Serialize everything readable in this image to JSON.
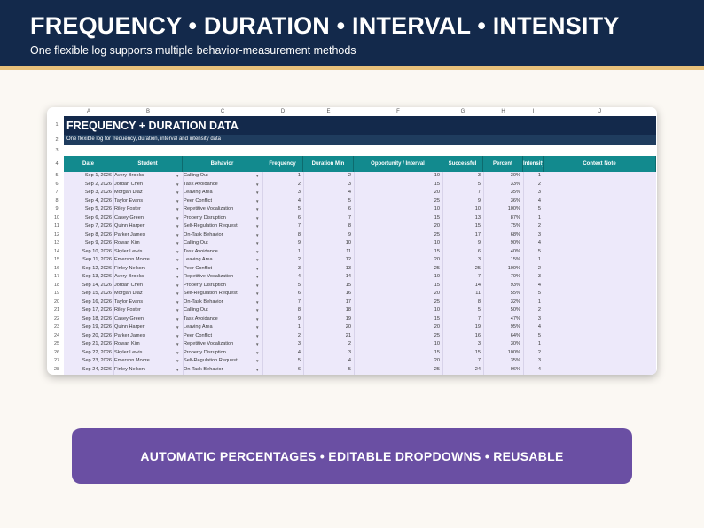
{
  "banner": {
    "title": "FREQUENCY • DURATION • INTERVAL • INTENSITY",
    "subtitle": "One flexible log supports multiple behavior-measurement methods"
  },
  "sheet": {
    "column_letters": [
      "A",
      "B",
      "C",
      "D",
      "E",
      "F",
      "G",
      "H",
      "I",
      "J"
    ],
    "title": "FREQUENCY + DURATION DATA",
    "subtitle": "One flexible log for frequency, duration, interval and intensity data",
    "headers": [
      "Date",
      "Student",
      "Behavior",
      "Frequency",
      "Duration Min",
      "Opportunity / Interval",
      "Successful",
      "Percent",
      "Intensity",
      "Context Note"
    ],
    "dropdown_glyph": "▼",
    "rows": [
      [
        "Sep 1, 2026",
        "Avery Brooks",
        "Calling Out",
        "1",
        "2",
        "10",
        "3",
        "30%",
        "1"
      ],
      [
        "Sep 2, 2026",
        "Jordan Chen",
        "Task Avoidance",
        "2",
        "3",
        "15",
        "5",
        "33%",
        "2"
      ],
      [
        "Sep 3, 2026",
        "Morgan Diaz",
        "Leaving Area",
        "3",
        "4",
        "20",
        "7",
        "35%",
        "3"
      ],
      [
        "Sep 4, 2026",
        "Taylor Evans",
        "Peer Conflict",
        "4",
        "5",
        "25",
        "9",
        "36%",
        "4"
      ],
      [
        "Sep 5, 2026",
        "Riley Foster",
        "Repetitive Vocalization",
        "5",
        "6",
        "10",
        "10",
        "100%",
        "5"
      ],
      [
        "Sep 6, 2026",
        "Casey Green",
        "Property Disruption",
        "6",
        "7",
        "15",
        "13",
        "87%",
        "1"
      ],
      [
        "Sep 7, 2026",
        "Quinn Harper",
        "Self-Regulation Request",
        "7",
        "8",
        "20",
        "15",
        "75%",
        "2"
      ],
      [
        "Sep 8, 2026",
        "Parker James",
        "On-Task Behavior",
        "8",
        "9",
        "25",
        "17",
        "68%",
        "3"
      ],
      [
        "Sep 9, 2026",
        "Rowan Kim",
        "Calling Out",
        "9",
        "10",
        "10",
        "9",
        "90%",
        "4"
      ],
      [
        "Sep 10, 2026",
        "Skyler Lewis",
        "Task Avoidance",
        "1",
        "11",
        "15",
        "6",
        "40%",
        "5"
      ],
      [
        "Sep 11, 2026",
        "Emerson Moore",
        "Leaving Area",
        "2",
        "12",
        "20",
        "3",
        "15%",
        "1"
      ],
      [
        "Sep 12, 2026",
        "Finley Nelson",
        "Peer Conflict",
        "3",
        "13",
        "25",
        "25",
        "100%",
        "2"
      ],
      [
        "Sep 13, 2026",
        "Avery Brooks",
        "Repetitive Vocalization",
        "4",
        "14",
        "10",
        "7",
        "70%",
        "3"
      ],
      [
        "Sep 14, 2026",
        "Jordan Chen",
        "Property Disruption",
        "5",
        "15",
        "15",
        "14",
        "93%",
        "4"
      ],
      [
        "Sep 15, 2026",
        "Morgan Diaz",
        "Self-Regulation Request",
        "6",
        "16",
        "20",
        "11",
        "55%",
        "5"
      ],
      [
        "Sep 16, 2026",
        "Taylor Evans",
        "On-Task Behavior",
        "7",
        "17",
        "25",
        "8",
        "32%",
        "1"
      ],
      [
        "Sep 17, 2026",
        "Riley Foster",
        "Calling Out",
        "8",
        "18",
        "10",
        "5",
        "50%",
        "2"
      ],
      [
        "Sep 18, 2026",
        "Casey Green",
        "Task Avoidance",
        "9",
        "19",
        "15",
        "7",
        "47%",
        "3"
      ],
      [
        "Sep 19, 2026",
        "Quinn Harper",
        "Leaving Area",
        "1",
        "20",
        "20",
        "19",
        "95%",
        "4"
      ],
      [
        "Sep 20, 2026",
        "Parker James",
        "Peer Conflict",
        "2",
        "21",
        "25",
        "16",
        "64%",
        "5"
      ],
      [
        "Sep 21, 2026",
        "Rowan Kim",
        "Repetitive Vocalization",
        "3",
        "2",
        "10",
        "3",
        "30%",
        "1"
      ],
      [
        "Sep 22, 2026",
        "Skyler Lewis",
        "Property Disruption",
        "4",
        "3",
        "15",
        "15",
        "100%",
        "2"
      ],
      [
        "Sep 23, 2026",
        "Emerson Moore",
        "Self-Regulation Request",
        "5",
        "4",
        "20",
        "7",
        "35%",
        "3"
      ],
      [
        "Sep 24, 2026",
        "Finley Nelson",
        "On-Task Behavior",
        "6",
        "5",
        "25",
        "24",
        "96%",
        "4"
      ]
    ]
  },
  "footer": {
    "tagline": "AUTOMATIC PERCENTAGES  •  EDITABLE DROPDOWNS  •  REUSABLE"
  },
  "colors": {
    "banner": "#13294b",
    "accent_stripe": "#e8c07a",
    "header_teal": "#128a8e",
    "data_fill": "#ede9fa",
    "pill": "#6a4fa3"
  }
}
